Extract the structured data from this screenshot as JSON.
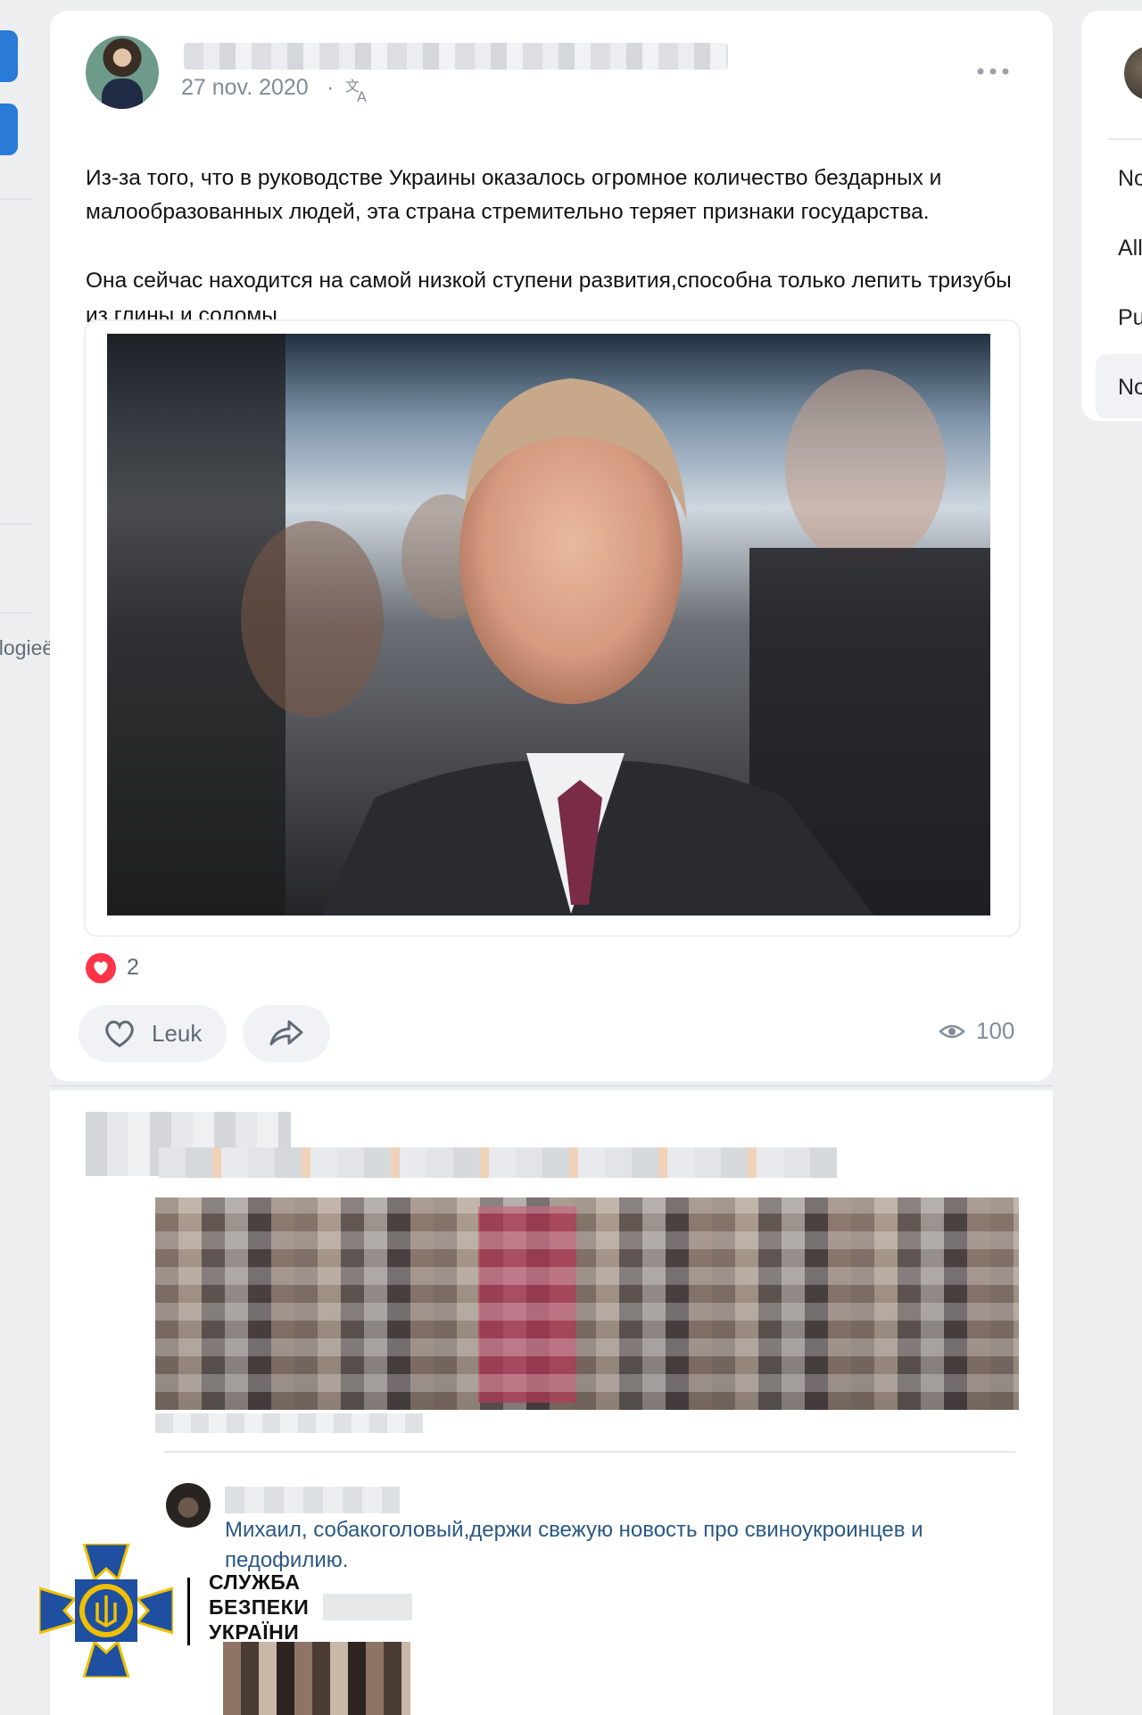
{
  "sidebar": {
    "partial_label": "ologieën"
  },
  "right_panel": {
    "items": [
      "No",
      "All",
      "Pu",
      "No"
    ]
  },
  "post": {
    "date": "27 nov. 2020",
    "separator": "·",
    "text_line1": "Из-за того, что в руководстве Украины оказалось огромное количество бездарных и малообразованных людей, эта страна стремительно теряет признаки государства.",
    "text_line2": "Она сейчас находится на самой низкой ступени развития,способна только лепить тризубы из глины и соломы.",
    "reaction_count": "2",
    "like_label": "Leuk",
    "views_count": "100"
  },
  "reply": {
    "text": "Михаил, собакоголовый,держи свежую новость про свиноукроинцев и педофилию."
  },
  "watermark": {
    "line1": "СЛУЖБА",
    "line2": "БЕЗПЕКИ",
    "line3": "УКРАЇНИ"
  },
  "colors": {
    "background": "#edeef0",
    "card": "#ffffff",
    "accent": "#2a7ad8",
    "heart": "#ff3347",
    "muted_text": "#818c99",
    "link_text": "#2a5885",
    "sbu_blue": "#1e4fa0",
    "sbu_gold": "#f0c000"
  },
  "icons": {
    "translate": "translate-icon",
    "more": "more-dots-icon",
    "heart": "heart-icon",
    "share": "share-arrow-icon",
    "eye": "eye-icon"
  }
}
